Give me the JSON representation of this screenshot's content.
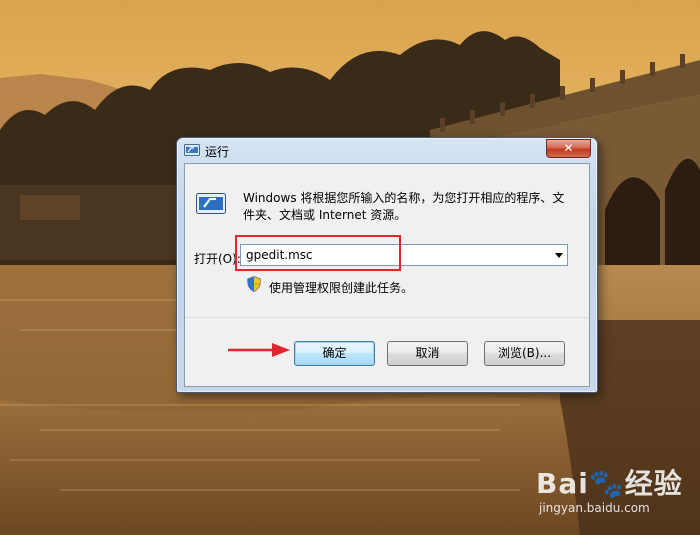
{
  "dialog": {
    "title": "运行",
    "close_label": "✕",
    "description": "Windows 将根据您所输入的名称，为您打开相应的程序、文件夹、文档或 Internet 资源。",
    "open_label": "打开(O):",
    "open_value": "gpedit.msc",
    "admin_note": "使用管理权限创建此任务。",
    "buttons": {
      "ok": "确定",
      "cancel": "取消",
      "browse": "浏览(B)..."
    }
  },
  "watermark": {
    "logo": "Bai🐾经验",
    "url": "jingyan.baidu.com"
  },
  "colors": {
    "annotation_red": "#e0252f",
    "titlebar_blue": "#c3d6ec"
  }
}
